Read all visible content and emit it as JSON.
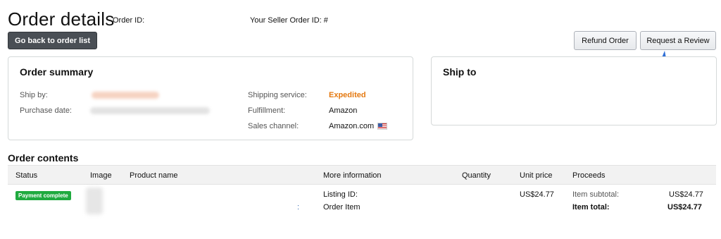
{
  "header": {
    "title": "Order details",
    "order_id_label": "Order ID:",
    "seller_order_id_label": "Your Seller Order ID: #",
    "back_button": "Go back to order list",
    "refund_button": "Refund Order",
    "review_button": "Request a Review"
  },
  "summary": {
    "title": "Order summary",
    "ship_by_label": "Ship by:",
    "purchase_date_label": "Purchase date:",
    "shipping_service_label": "Shipping service:",
    "shipping_service_value": "Expedited",
    "fulfillment_label": "Fulfillment:",
    "fulfillment_value": "Amazon",
    "sales_channel_label": "Sales channel:",
    "sales_channel_value": "Amazon.com"
  },
  "ship_to": {
    "title": "Ship to"
  },
  "contents": {
    "title": "Order contents",
    "columns": [
      "Status",
      "Image",
      "Product name",
      "More information",
      "Quantity",
      "Unit price",
      "Proceeds"
    ],
    "row": {
      "status": "Payment complete",
      "listing_id_label": "Listing ID:",
      "order_item_label": "Order Item",
      "colon": ":",
      "unit_price": "US$24.77",
      "item_subtotal_label": "Item subtotal:",
      "item_subtotal_value": "US$24.77",
      "item_total_label": "Item total:",
      "item_total_value": "US$24.77"
    }
  },
  "colors": {
    "accent_orange": "#e47911",
    "badge_green": "#1faa3f",
    "arrow_blue": "#2f6fd6"
  }
}
